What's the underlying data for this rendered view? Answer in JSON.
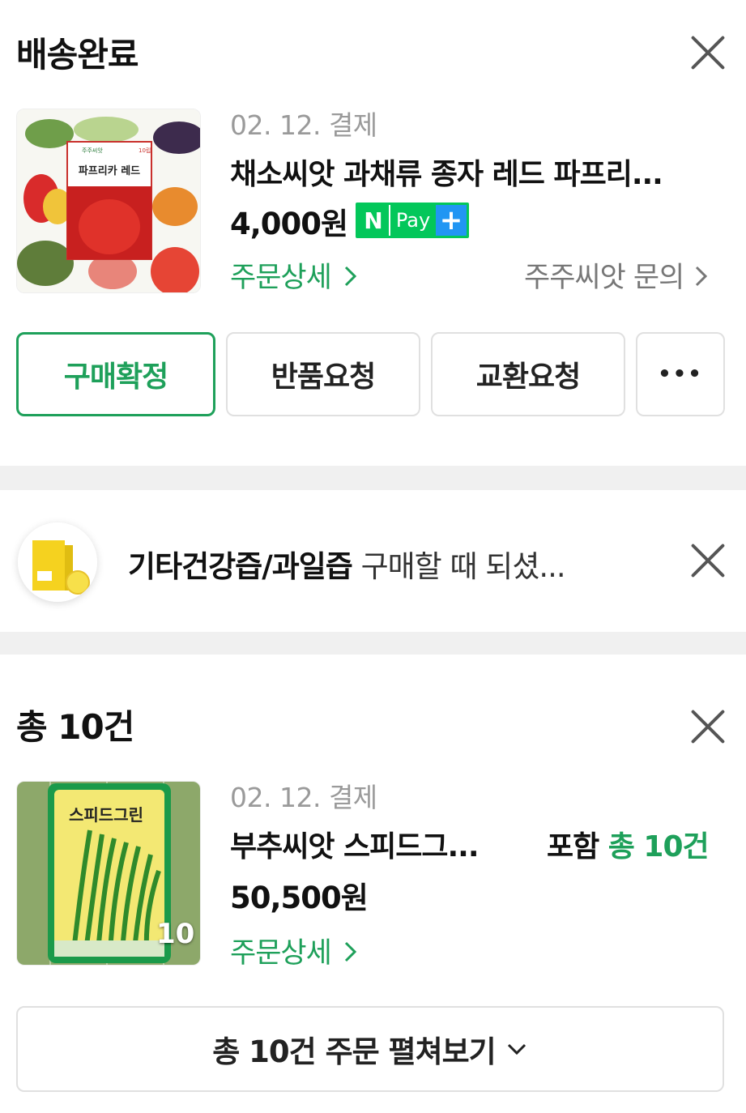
{
  "delivered": {
    "title": "배송완료",
    "date": "02. 12. 결제",
    "product_name": "채소씨앗 과채류 종자 레드 파프리...",
    "price": "4,000원",
    "npay": {
      "n": "N",
      "pay": "Pay",
      "plus": "+"
    },
    "detail_link": "주문상세",
    "inquiry_link": "주주씨앗 문의",
    "buttons": {
      "confirm": "구매확정",
      "return": "반품요청",
      "exchange": "교환요청",
      "more": "•••"
    },
    "thumb_label": {
      "brand": "주주씨앗",
      "name": "파프리카 레드",
      "count": "10립"
    }
  },
  "promo": {
    "category": "기타건강즙/과일즙",
    "message": " 구매할 때 되셨..."
  },
  "orders": {
    "title": "총 10건",
    "date": "02. 12. 결제",
    "product_name": "부추씨앗 스피드그...",
    "included_prefix": "포함 ",
    "included_count": "총 10건",
    "price": "50,500원",
    "detail_link": "주문상세",
    "thumb_count": "10",
    "thumb_label": "스피드그린",
    "expand_label": "총 10건 주문 펼쳐보기"
  },
  "colors": {
    "accent_green": "#1ea05a",
    "npay_green": "#03c75a",
    "npay_blue": "#2196f3",
    "divider": "#f0f0f0"
  }
}
